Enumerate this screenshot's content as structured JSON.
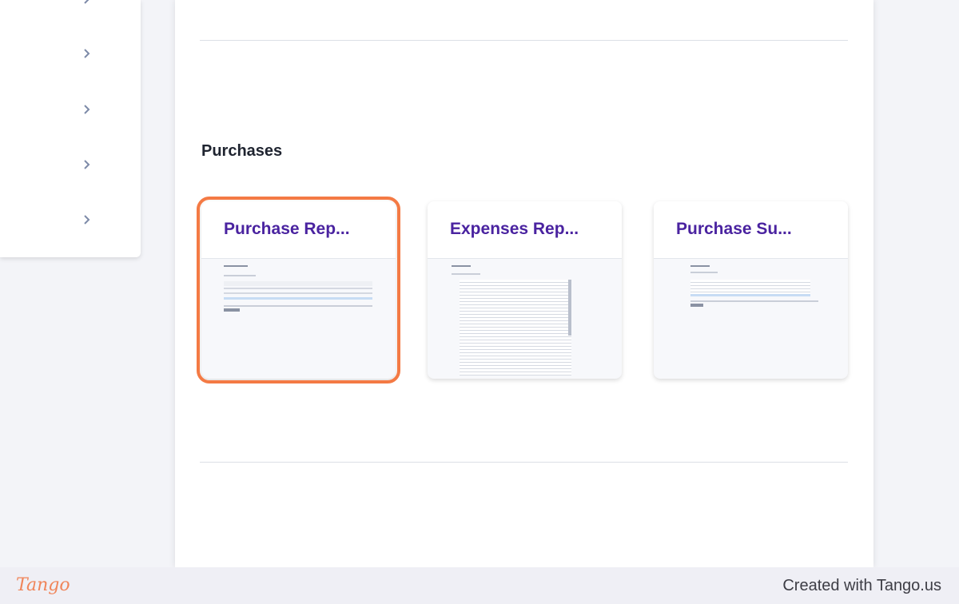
{
  "sidebar": {
    "items": [
      {
        "icon": "chevron-right-icon"
      },
      {
        "icon": "chevron-right-icon"
      },
      {
        "icon": "chevron-right-icon"
      },
      {
        "icon": "chevron-right-icon"
      }
    ]
  },
  "section": {
    "title": "Purchases"
  },
  "cards": [
    {
      "title": "Purchase Rep...",
      "thumb_title": "Purchase Report",
      "selected": true
    },
    {
      "title": "Expenses Rep...",
      "thumb_title": "Expenses Report",
      "selected": false
    },
    {
      "title": "Purchase Su...",
      "thumb_title": "Purchase Summary",
      "selected": false
    }
  ],
  "footer": {
    "logo": "Tango",
    "credit": "Created with Tango.us"
  },
  "colors": {
    "highlight": "#f47a44",
    "card_title": "#4a23a0",
    "chevron": "#7d8aa8",
    "logo": "#f0855a"
  }
}
